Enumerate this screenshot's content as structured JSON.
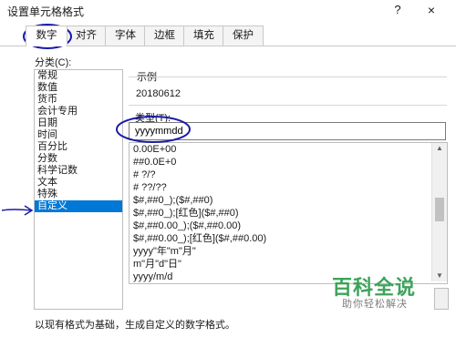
{
  "window": {
    "title": "设置单元格格式",
    "help": "?",
    "close": "×"
  },
  "tabs": [
    {
      "label": "数字",
      "active": true
    },
    {
      "label": "对齐",
      "active": false
    },
    {
      "label": "字体",
      "active": false
    },
    {
      "label": "边框",
      "active": false
    },
    {
      "label": "填充",
      "active": false
    },
    {
      "label": "保护",
      "active": false
    }
  ],
  "category": {
    "label": "分类(C):",
    "items": [
      "常规",
      "数值",
      "货币",
      "会计专用",
      "日期",
      "时间",
      "百分比",
      "分数",
      "科学记数",
      "文本",
      "特殊",
      "自定义"
    ],
    "selected": "自定义"
  },
  "sample": {
    "label": "示例",
    "value": "20180612"
  },
  "type": {
    "label": "类型(T):",
    "value": "yyyymmdd",
    "list": [
      "0.00E+00",
      "##0.0E+0",
      "# ?/?",
      "# ??/??",
      "$#,##0_);($#,##0)",
      "$#,##0_);[红色]($#,##0)",
      "$#,##0.00_);($#,##0.00)",
      "$#,##0.00_);[红色]($#,##0.00)",
      "yyyy\"年\"m\"月\"",
      "m\"月\"d\"日\"",
      "yyyy/m/d"
    ]
  },
  "hint": "以现有格式为基础，生成自定义的数字格式。",
  "watermark": {
    "big": "百科全说",
    "small": "助你轻松解决"
  },
  "colors": {
    "selected": "#0078d7",
    "annotation": "#1a1aa8",
    "watermark": "#3da35a"
  }
}
